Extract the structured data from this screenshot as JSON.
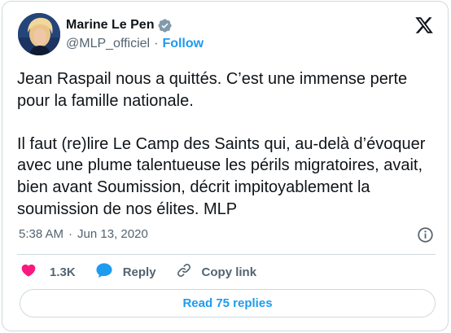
{
  "author": {
    "name": "Marine Le Pen",
    "handle": "@MLP_officiel",
    "separator": "·",
    "follow_label": "Follow",
    "verified": true
  },
  "tweet": {
    "paragraph1": "Jean Raspail nous a quittés. C’est une immense perte pour la famille nationale.",
    "paragraph2": "Il faut (re)lire Le Camp des Saints qui, au-delà d’évoquer avec une plume talentueuse les périls migratoires, avait, bien avant Soumission, décrit impitoyablement la soumission de nos élites. MLP"
  },
  "meta": {
    "time": "5:38 AM",
    "separator": "·",
    "date": "Jun 13, 2020"
  },
  "actions": {
    "likes": "1.3K",
    "reply_label": "Reply",
    "copy_label": "Copy link"
  },
  "read_replies_label": "Read 75 replies",
  "colors": {
    "accent": "#1d9bf0",
    "like": "#f91880",
    "text": "#0f1419",
    "secondary": "#536471",
    "border": "#cfd9de"
  },
  "icons": [
    "verified-badge-icon",
    "x-logo-icon",
    "info-icon",
    "heart-icon",
    "reply-bubble-icon",
    "link-icon"
  ]
}
